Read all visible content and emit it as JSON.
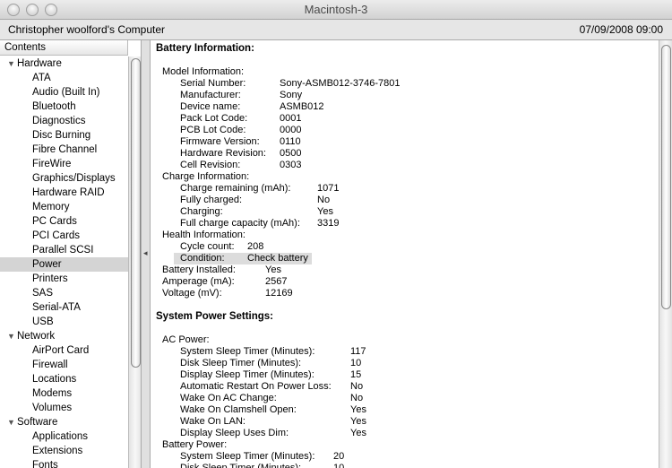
{
  "window": {
    "title": "Macintosh-3",
    "computer_name": "Christopher woolford's Computer",
    "datetime": "07/09/2008 09:00"
  },
  "sidebar": {
    "header": "Contents",
    "items": [
      {
        "label": "Hardware",
        "level": 0,
        "expanded": true
      },
      {
        "label": "ATA",
        "level": 1
      },
      {
        "label": "Audio (Built In)",
        "level": 1
      },
      {
        "label": "Bluetooth",
        "level": 1
      },
      {
        "label": "Diagnostics",
        "level": 1
      },
      {
        "label": "Disc Burning",
        "level": 1
      },
      {
        "label": "Fibre Channel",
        "level": 1
      },
      {
        "label": "FireWire",
        "level": 1
      },
      {
        "label": "Graphics/Displays",
        "level": 1
      },
      {
        "label": "Hardware RAID",
        "level": 1
      },
      {
        "label": "Memory",
        "level": 1
      },
      {
        "label": "PC Cards",
        "level": 1
      },
      {
        "label": "PCI Cards",
        "level": 1
      },
      {
        "label": "Parallel SCSI",
        "level": 1
      },
      {
        "label": "Power",
        "level": 1,
        "selected": true
      },
      {
        "label": "Printers",
        "level": 1
      },
      {
        "label": "SAS",
        "level": 1
      },
      {
        "label": "Serial-ATA",
        "level": 1
      },
      {
        "label": "USB",
        "level": 1
      },
      {
        "label": "Network",
        "level": 0,
        "expanded": true
      },
      {
        "label": "AirPort Card",
        "level": 1
      },
      {
        "label": "Firewall",
        "level": 1
      },
      {
        "label": "Locations",
        "level": 1
      },
      {
        "label": "Modems",
        "level": 1
      },
      {
        "label": "Volumes",
        "level": 1
      },
      {
        "label": "Software",
        "level": 0,
        "expanded": true
      },
      {
        "label": "Applications",
        "level": 1
      },
      {
        "label": "Extensions",
        "level": 1
      },
      {
        "label": "Fonts",
        "level": 1
      }
    ]
  },
  "content": {
    "lines": [
      {
        "t": "h",
        "text": "Battery Information:"
      },
      {
        "t": "gap"
      },
      {
        "t": "sub",
        "text": "Model Information:"
      },
      {
        "t": "kv",
        "g": "m",
        "k": "Serial Number:",
        "v": "Sony-ASMB012-3746-7801"
      },
      {
        "t": "kv",
        "g": "m",
        "k": "Manufacturer:",
        "v": "Sony"
      },
      {
        "t": "kv",
        "g": "m",
        "k": "Device name:",
        "v": "ASMB012"
      },
      {
        "t": "kv",
        "g": "m",
        "k": "Pack Lot Code:",
        "v": "0001"
      },
      {
        "t": "kv",
        "g": "m",
        "k": "PCB Lot Code:",
        "v": "0000"
      },
      {
        "t": "kv",
        "g": "m",
        "k": "Firmware Version:",
        "v": "0110"
      },
      {
        "t": "kv",
        "g": "m",
        "k": "Hardware Revision:",
        "v": "0500"
      },
      {
        "t": "kv",
        "g": "m",
        "k": "Cell Revision:",
        "v": "0303"
      },
      {
        "t": "sub",
        "text": "Charge Information:"
      },
      {
        "t": "kv",
        "g": "c",
        "k": "Charge remaining (mAh):",
        "v": "1071"
      },
      {
        "t": "kv",
        "g": "c",
        "k": "Fully charged:",
        "v": "No"
      },
      {
        "t": "kv",
        "g": "c",
        "k": "Charging:",
        "v": "Yes"
      },
      {
        "t": "kv",
        "g": "c",
        "k": "Full charge capacity (mAh):",
        "v": "3319"
      },
      {
        "t": "sub",
        "text": "Health Information:"
      },
      {
        "t": "kv",
        "g": "hl",
        "k": "Cycle count:",
        "v": "208"
      },
      {
        "t": "kv",
        "g": "hl",
        "k": "Condition:",
        "v": "Check battery",
        "highlight": true
      },
      {
        "t": "kv1",
        "g": "b",
        "k": "Battery Installed:",
        "v": "Yes"
      },
      {
        "t": "kv1",
        "g": "b",
        "k": "Amperage (mA):",
        "v": "2567"
      },
      {
        "t": "kv1",
        "g": "b",
        "k": "Voltage (mV):",
        "v": "12169"
      },
      {
        "t": "gap"
      },
      {
        "t": "h",
        "text": "System Power Settings:"
      },
      {
        "t": "gap"
      },
      {
        "t": "sub",
        "text": "AC Power:"
      },
      {
        "t": "kv",
        "g": "a",
        "k": "System Sleep Timer (Minutes):",
        "v": "117"
      },
      {
        "t": "kv",
        "g": "a",
        "k": "Disk Sleep Timer (Minutes):",
        "v": "10"
      },
      {
        "t": "kv",
        "g": "a",
        "k": "Display Sleep Timer (Minutes):",
        "v": "15"
      },
      {
        "t": "kv",
        "g": "a",
        "k": "Automatic Restart On Power Loss:",
        "v": "No"
      },
      {
        "t": "kv",
        "g": "a",
        "k": "Wake On AC Change:",
        "v": "No"
      },
      {
        "t": "kv",
        "g": "a",
        "k": "Wake On Clamshell Open:",
        "v": "Yes"
      },
      {
        "t": "kv",
        "g": "a",
        "k": "Wake On LAN:",
        "v": "Yes"
      },
      {
        "t": "kv",
        "g": "a",
        "k": "Display Sleep Uses Dim:",
        "v": "Yes"
      },
      {
        "t": "sub",
        "text": "Battery Power:"
      },
      {
        "t": "kv",
        "g": "bp",
        "k": "System Sleep Timer (Minutes):",
        "v": "20"
      },
      {
        "t": "kv",
        "g": "bp",
        "k": "Disk Sleep Timer (Minutes):",
        "v": "10"
      }
    ]
  }
}
